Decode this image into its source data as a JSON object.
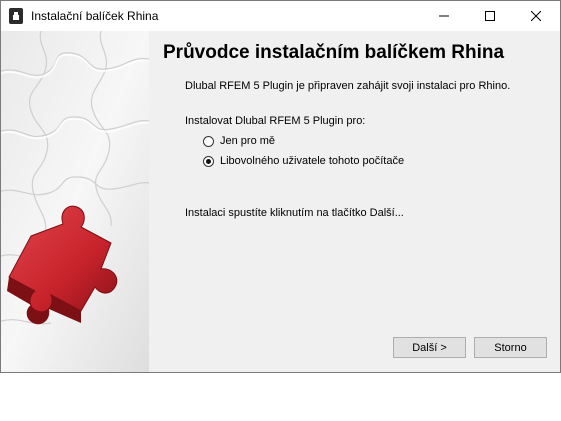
{
  "window": {
    "title": "Instalační balíček Rhina",
    "controls": {
      "minimize_icon": "minimize-icon",
      "maximize_icon": "maximize-icon",
      "close_icon": "close-icon"
    }
  },
  "wizard": {
    "heading": "Průvodce instalačním balíčkem Rhina",
    "intro": "Dlubal RFEM 5 Plugin je připraven zahájit svoji instalaci pro Rhino.",
    "install_for_label": "Instalovat Dlubal RFEM 5 Plugin pro:",
    "options": [
      {
        "label": "Jen pro mě",
        "selected": false
      },
      {
        "label": "Libovolného uživatele tohoto počítače",
        "selected": true
      }
    ],
    "hint": "Instalaci spustíte kliknutím na tlačítko Další...",
    "buttons": {
      "next": "Další >",
      "cancel": "Storno"
    }
  },
  "colors": {
    "puzzle_accent": "#c8232c",
    "panel_background": "#f0f0f0"
  }
}
